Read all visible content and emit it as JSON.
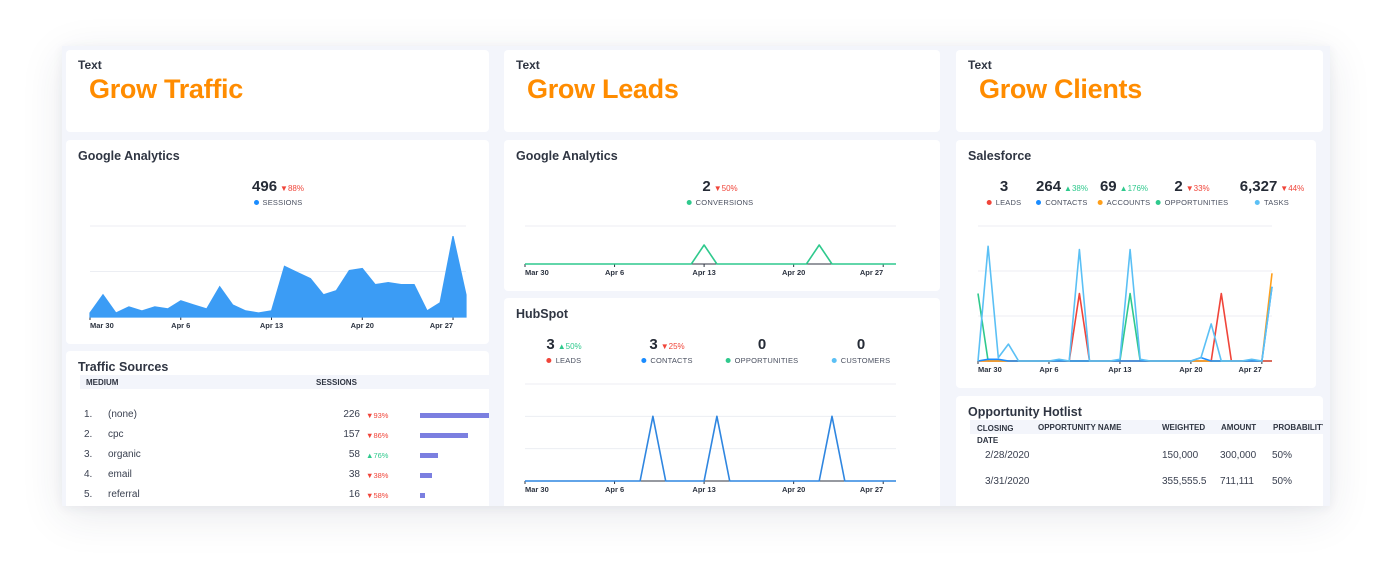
{
  "columns": [
    {
      "header_card": {
        "label": "Text",
        "title": "Grow Traffic"
      },
      "widgets": [
        {
          "title": "Google Analytics",
          "kpis": [
            {
              "value": "496",
              "delta": "88%",
              "direction": "down",
              "label": "SESSIONS",
              "color": "#1a8cff"
            }
          ]
        },
        {
          "title": "Traffic Sources",
          "table": {
            "headers": [
              "MEDIUM",
              "SESSIONS"
            ],
            "rows": [
              {
                "rank": "1.",
                "medium": "(none)",
                "sessions": "226",
                "delta": "93%",
                "direction": "down",
                "share": 1.0
              },
              {
                "rank": "2.",
                "medium": "cpc",
                "sessions": "157",
                "delta": "86%",
                "direction": "down",
                "share": 0.69
              },
              {
                "rank": "3.",
                "medium": "organic",
                "sessions": "58",
                "delta": "76%",
                "direction": "up",
                "share": 0.26
              },
              {
                "rank": "4.",
                "medium": "email",
                "sessions": "38",
                "delta": "38%",
                "direction": "down",
                "share": 0.17
              },
              {
                "rank": "5.",
                "medium": "referral",
                "sessions": "16",
                "delta": "58%",
                "direction": "down",
                "share": 0.07
              }
            ]
          }
        }
      ]
    },
    {
      "header_card": {
        "label": "Text",
        "title": "Grow Leads"
      },
      "widgets": [
        {
          "title": "Google Analytics",
          "kpis": [
            {
              "value": "2",
              "delta": "50%",
              "direction": "down",
              "label": "CONVERSIONS",
              "color": "#2fc98d"
            }
          ]
        },
        {
          "title": "HubSpot",
          "kpis": [
            {
              "value": "3",
              "delta": "50%",
              "direction": "up",
              "label": "LEADS",
              "color": "#f0453a"
            },
            {
              "value": "3",
              "delta": "25%",
              "direction": "down",
              "label": "CONTACTS",
              "color": "#1a8cff"
            },
            {
              "value": "0",
              "delta": "",
              "direction": "",
              "label": "OPPORTUNITIES",
              "color": "#2fc98d"
            },
            {
              "value": "0",
              "delta": "",
              "direction": "",
              "label": "CUSTOMERS",
              "color": "#5bc0f5"
            }
          ]
        }
      ]
    },
    {
      "header_card": {
        "label": "Text",
        "title": "Grow Clients"
      },
      "widgets": [
        {
          "title": "Salesforce",
          "kpis": [
            {
              "value": "3",
              "delta": "",
              "direction": "",
              "label": "LEADS",
              "color": "#f0453a"
            },
            {
              "value": "264",
              "delta": "38%",
              "direction": "up",
              "label": "CONTACTS",
              "color": "#1a8cff"
            },
            {
              "value": "69",
              "delta": "176%",
              "direction": "up",
              "label": "ACCOUNTS",
              "color": "#ff9f1a"
            },
            {
              "value": "2",
              "delta": "33%",
              "direction": "down",
              "label": "OPPORTUNITIES",
              "color": "#2fc98d"
            },
            {
              "value": "6,327",
              "delta": "44%",
              "direction": "down",
              "label": "TASKS",
              "color": "#5bc0f5"
            }
          ]
        },
        {
          "title": "Opportunity Hotlist",
          "table": {
            "headers": [
              "CLOSING DATE",
              "OPPORTUNITY NAME",
              "WEIGHTED",
              "AMOUNT",
              "PROBABILITY"
            ],
            "rows": [
              {
                "closing_date": "2/28/2020",
                "name": "",
                "weighted": "150,000",
                "amount": "300,000",
                "probability": "50%"
              },
              {
                "closing_date": "3/31/2020",
                "name": "",
                "weighted": "355,555.5",
                "amount": "711,111",
                "probability": "50%"
              }
            ]
          }
        }
      ]
    }
  ],
  "chart_data": [
    {
      "id": "ga-sessions",
      "type": "area",
      "title": "Google Analytics",
      "x_ticks": [
        "Mar 30",
        "Apr 6",
        "Apr 13",
        "Apr 20",
        "Apr 27"
      ],
      "x_range": [
        0,
        29
      ],
      "ylim": [
        0,
        45
      ],
      "grid": true,
      "series": [
        {
          "name": "Sessions",
          "color": "#3b9cf5",
          "values": [
            2,
            11,
            2,
            5,
            3,
            5,
            4,
            8,
            6,
            4,
            15,
            6,
            3,
            2,
            3,
            25,
            22,
            19,
            11,
            13,
            23,
            24,
            16,
            17,
            16,
            16,
            3,
            7,
            40,
            11
          ]
        }
      ]
    },
    {
      "id": "ga-conversions",
      "type": "line",
      "title": "Google Analytics",
      "x_ticks": [
        "Mar 30",
        "Apr 6",
        "Apr 13",
        "Apr 20",
        "Apr 27"
      ],
      "x_range": [
        0,
        29
      ],
      "ylim": [
        0,
        2
      ],
      "grid": true,
      "series": [
        {
          "name": "Conversions",
          "color": "#2fc98d",
          "values": [
            0,
            0,
            0,
            0,
            0,
            0,
            0,
            0,
            0,
            0,
            0,
            0,
            0,
            0,
            1,
            0,
            0,
            0,
            0,
            0,
            0,
            0,
            0,
            1,
            0,
            0,
            0,
            0,
            0,
            0
          ]
        }
      ]
    },
    {
      "id": "hubspot",
      "type": "line",
      "title": "HubSpot",
      "x_ticks": [
        "Mar 30",
        "Apr 6",
        "Apr 13",
        "Apr 20",
        "Apr 27"
      ],
      "x_range": [
        0,
        29
      ],
      "ylim": [
        0,
        3
      ],
      "grid": true,
      "series": [
        {
          "name": "Contacts",
          "color": "#2f86e0",
          "values": [
            0,
            0,
            0,
            0,
            0,
            0,
            0,
            0,
            0,
            0,
            2,
            0,
            0,
            0,
            0,
            2,
            0,
            0,
            0,
            0,
            0,
            0,
            0,
            0,
            2,
            0,
            0,
            0,
            0,
            0
          ]
        }
      ]
    },
    {
      "id": "salesforce",
      "type": "line",
      "title": "Salesforce",
      "x_ticks": [
        "Mar 30",
        "Apr 6",
        "Apr 13",
        "Apr 20",
        "Apr 27"
      ],
      "x_range": [
        0,
        29
      ],
      "ylim": [
        0,
        4
      ],
      "grid": true,
      "series": [
        {
          "name": "Opportunities",
          "color": "#2fc98d",
          "values": [
            2,
            0,
            0,
            0,
            0,
            0,
            0,
            0,
            0,
            0,
            0,
            0,
            0,
            0,
            0,
            2,
            0,
            0,
            0,
            0,
            0,
            0,
            0,
            0,
            0,
            0,
            0,
            0,
            0,
            0
          ]
        },
        {
          "name": "Leads",
          "color": "#f0453a",
          "values": [
            0,
            0,
            0,
            0,
            0,
            0,
            0,
            0,
            0,
            0,
            2,
            0,
            0,
            0,
            0,
            0,
            0,
            0,
            0,
            0,
            0,
            0,
            0,
            0,
            2,
            0,
            0,
            0,
            0,
            0
          ]
        },
        {
          "name": "Accounts",
          "color": "#ff9f1a",
          "values": [
            0,
            0,
            0,
            0,
            0,
            0,
            0,
            0,
            0,
            0,
            0,
            0,
            0,
            0,
            0,
            0,
            0,
            0,
            0,
            0,
            0,
            0,
            0,
            0,
            0,
            0,
            0,
            0,
            0,
            2.6
          ]
        },
        {
          "name": "Contacts",
          "color": "#1a8cff",
          "values": [
            0,
            0.05,
            0.05,
            0,
            0,
            0,
            0,
            0,
            0,
            0,
            0,
            0,
            0,
            0,
            0,
            0,
            0,
            0,
            0,
            0,
            0,
            0,
            0.1,
            0,
            0,
            0,
            0,
            0,
            0,
            2.2
          ]
        },
        {
          "name": "Tasks",
          "color": "#5bc0f5",
          "values": [
            0,
            3.4,
            0.1,
            0.5,
            0,
            0,
            0,
            0,
            0.05,
            0,
            3.3,
            0,
            0,
            0,
            0.05,
            3.3,
            0.05,
            0,
            0,
            0,
            0,
            0,
            0.1,
            1.1,
            0,
            0,
            0,
            0.05,
            0,
            2.2
          ]
        }
      ]
    }
  ]
}
